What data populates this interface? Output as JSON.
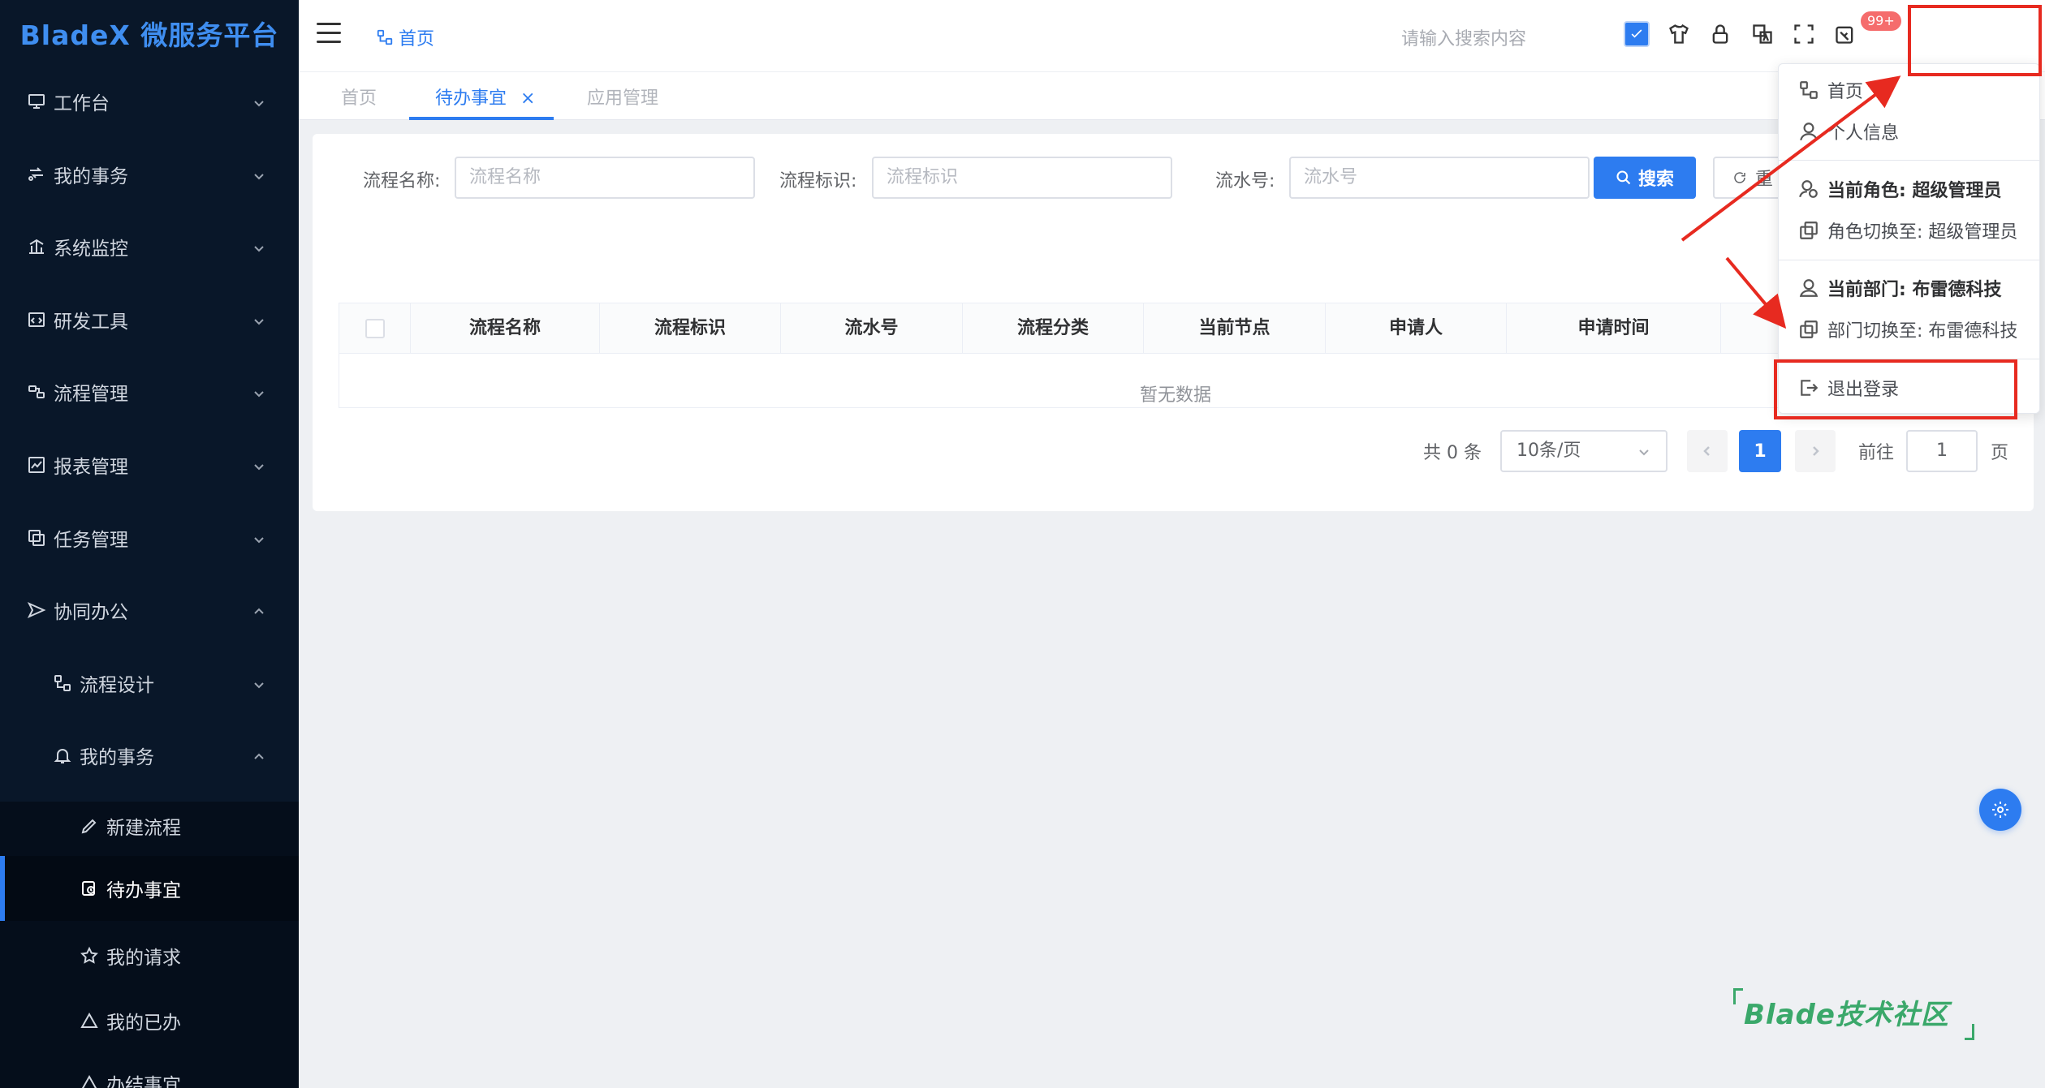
{
  "app": {
    "logo": "BladeX 微服务平台"
  },
  "sidebar": {
    "items": [
      {
        "label": "工作台"
      },
      {
        "label": "我的事务"
      },
      {
        "label": "系统监控"
      },
      {
        "label": "研发工具"
      },
      {
        "label": "流程管理"
      },
      {
        "label": "报表管理"
      },
      {
        "label": "任务管理"
      },
      {
        "label": "协同办公"
      },
      {
        "label": "流程设计"
      },
      {
        "label": "我的事务"
      },
      {
        "label": "新建流程"
      },
      {
        "label": "待办事宜"
      },
      {
        "label": "我的请求"
      },
      {
        "label": "我的已办"
      },
      {
        "label": "办结事宜"
      }
    ]
  },
  "header": {
    "breadcrumb": "首页",
    "search_placeholder": "请输入搜索内容",
    "badge": "99+"
  },
  "tags": {
    "items": [
      "首页",
      "待办事宜",
      "应用管理"
    ],
    "close": "×"
  },
  "filters": {
    "name_label": "流程名称:",
    "name_placeholder": "流程名称",
    "key_label": "流程标识:",
    "key_placeholder": "流程标识",
    "serial_label": "流水号:",
    "serial_placeholder": "流水号",
    "search_button": "搜索",
    "reset_button": "重"
  },
  "table": {
    "columns": [
      "流程名称",
      "流程标识",
      "流水号",
      "流程分类",
      "当前节点",
      "申请人",
      "申请时间"
    ],
    "empty_text": "暂无数据"
  },
  "pagination": {
    "total": "共 0 条",
    "page_size": "10条/页",
    "current": "1",
    "goto_label": "前往",
    "goto_value": "1",
    "page_suffix": "页"
  },
  "dropdown": {
    "home": "首页",
    "profile": "个人信息",
    "current_role": "当前角色: 超级管理员",
    "switch_role": "角色切换至: 超级管理员",
    "current_dept": "当前部门: 布雷德科技",
    "switch_dept": "部门切换至: 布雷德科技",
    "logout": "退出登录"
  },
  "watermark": "Blade技术社区",
  "colors": {
    "primary": "#2d7cf0",
    "sidebar_bg": "#091729",
    "annotation_red": "#e72a20"
  }
}
